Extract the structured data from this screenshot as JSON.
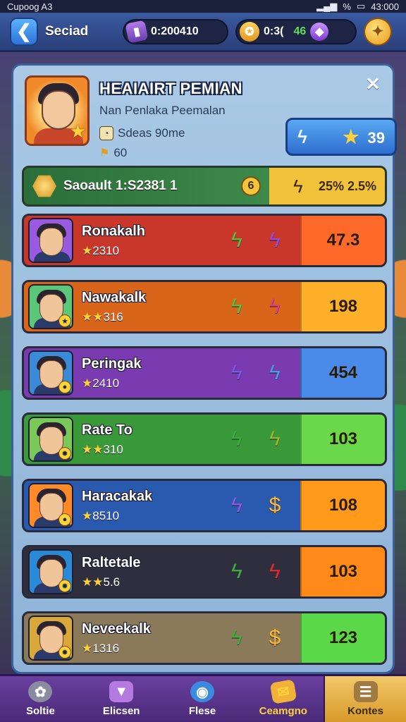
{
  "status_bar": {
    "left": "Cupoog A3",
    "signal": "%",
    "time": "43:000"
  },
  "top_bar": {
    "title": "Seciad",
    "currency_1": "0:200410",
    "currency_2_a": "0:3(",
    "currency_2_b": "46",
    "back_icon": "arrow-left-icon",
    "coin_icon": "coin-icon"
  },
  "player": {
    "name": "HEAIAIRT PEMIAN",
    "subtitle": "Nan Penlaka Peemalan",
    "stat_1": "Sdeas 90me",
    "stat_2": "60",
    "score": "39"
  },
  "season": {
    "label": "Saoault 1:S2381 1",
    "coin": "6",
    "percent": "25% 2.5%"
  },
  "rows": [
    {
      "name": "Ronakalh",
      "stars": "★",
      "rating": "2310",
      "value": "47.3",
      "bg": "#c9362a",
      "value_bg": "#ff6a2a",
      "ic1": "#59c23a",
      "ic2": "#9b4ae0",
      "avatar_bg": "#9a5ae0"
    },
    {
      "name": "Nawakalk",
      "stars": "★★",
      "rating": "316",
      "value": "198",
      "bg": "#d8651a",
      "value_bg": "#ffb02a",
      "ic1": "#59c23a",
      "ic2": "#e0407a",
      "avatar_bg": "#5ac878"
    },
    {
      "name": "Peringak",
      "stars": "★",
      "rating": "2410",
      "value": "454",
      "bg": "#7a3ab0",
      "value_bg": "#4a8ae8",
      "ic1": "#7a5ae0",
      "ic2": "#4a9ae8",
      "avatar_bg": "#3a8ad8"
    },
    {
      "name": "Rate To",
      "stars": "★★",
      "rating": "310",
      "value": "103",
      "bg": "#3a9a3a",
      "value_bg": "#6ad84a",
      "ic1": "#3ab03a",
      "ic2": "#9ab82a",
      "avatar_bg": "#7ac85a"
    },
    {
      "name": "Haracakak",
      "stars": "★",
      "rating": "8510",
      "value": "108",
      "bg": "#2a5ab0",
      "value_bg": "#ff9a1a",
      "ic1": "#8a5ae0",
      "ic2": "#ffb82a",
      "avatar_bg": "#ff8a2a"
    },
    {
      "name": "Raltetale",
      "stars": "★★",
      "rating": "5.6",
      "value": "103",
      "bg": "#2e2e3e",
      "value_bg": "#ff8a1a",
      "ic1": "#3ab03a",
      "ic2": "#e02a2a",
      "avatar_bg": "#2a8ad8"
    },
    {
      "name": "Neveekalk",
      "stars": "★",
      "rating": "1316",
      "value": "123",
      "bg": "#8a7a5a",
      "value_bg": "#5ad84a",
      "ic1": "#3ab03a",
      "ic2": "#ffb82a",
      "avatar_bg": "#d8a83a"
    }
  ],
  "nav": [
    {
      "label": "Soltie",
      "icon": "settings-icon"
    },
    {
      "label": "Elicsen",
      "icon": "cup-icon"
    },
    {
      "label": "Flese",
      "icon": "water-drop-icon"
    },
    {
      "label": "Ceamgno",
      "icon": "ticket-icon"
    },
    {
      "label": "Kontes",
      "icon": "box-icon"
    }
  ]
}
